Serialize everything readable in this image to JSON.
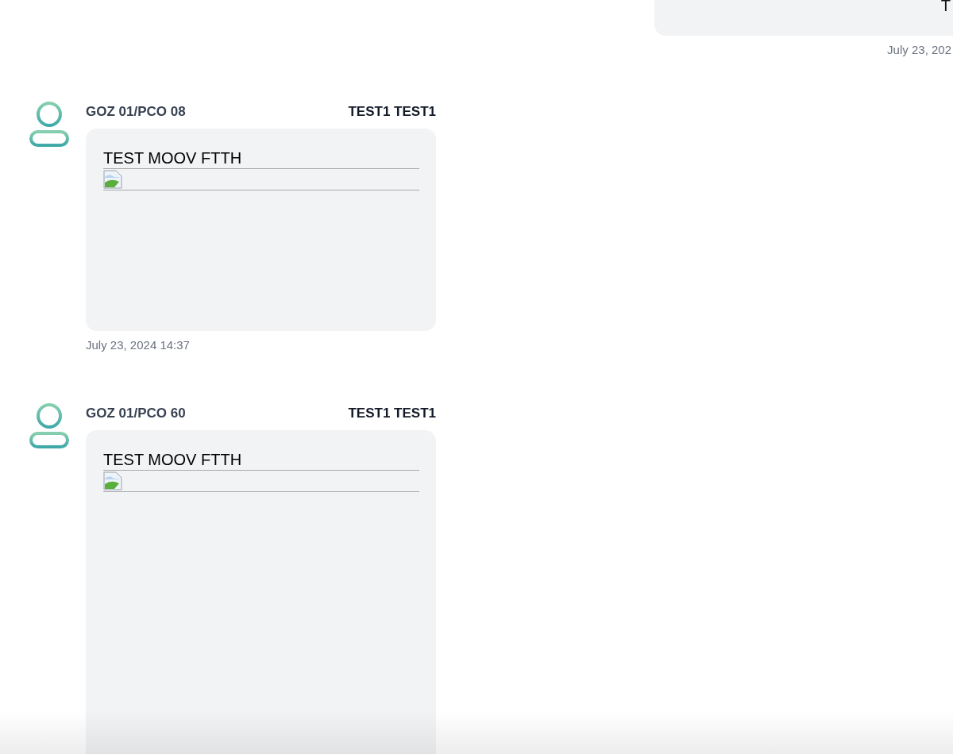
{
  "top_message": {
    "text": "T",
    "timestamp": "July 23, 202"
  },
  "messages": [
    {
      "sender": "GOZ 01/PCO 08",
      "author": "TEST1 TEST1",
      "text": "TEST MOOV FTTH",
      "attachment": {
        "kind": "broken-image"
      },
      "timestamp": "July 23, 2024 14:37"
    },
    {
      "sender": "GOZ 01/PCO 60",
      "author": "TEST1 TEST1",
      "text": "TEST MOOV FTTH",
      "attachment": {
        "kind": "broken-image"
      }
    }
  ]
}
